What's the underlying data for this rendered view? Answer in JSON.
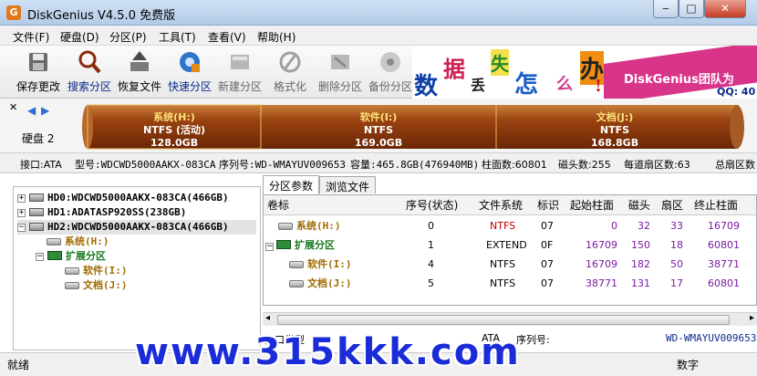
{
  "window": {
    "title": "DiskGenius V4.5.0 免费版",
    "icon_letter": "G"
  },
  "menu": [
    "文件(F)",
    "硬盘(D)",
    "分区(P)",
    "工具(T)",
    "查看(V)",
    "帮助(H)"
  ],
  "toolbar": [
    {
      "label": "保存更改",
      "icon": "save-icon"
    },
    {
      "label": "搜索分区",
      "icon": "search-partition-icon"
    },
    {
      "label": "恢复文件",
      "icon": "recover-file-icon"
    },
    {
      "label": "快速分区",
      "icon": "quick-partition-icon"
    },
    {
      "label": "新建分区",
      "icon": "new-partition-icon"
    },
    {
      "label": "格式化",
      "icon": "format-icon"
    },
    {
      "label": "删除分区",
      "icon": "delete-partition-icon"
    },
    {
      "label": "备份分区",
      "icon": "backup-partition-icon"
    }
  ],
  "banner": {
    "chars": [
      "数",
      "据",
      "丢",
      "失",
      "怎",
      "么",
      "办",
      "!"
    ],
    "brand": "DiskGenius团队为",
    "qq": "QQ: 40"
  },
  "disk": {
    "label": "硬盘 2",
    "partitions": [
      {
        "name": "系统(H:)",
        "fs": "NTFS (活动)",
        "size": "128.0GB"
      },
      {
        "name": "软件(I:)",
        "fs": "NTFS",
        "size": "169.0GB"
      },
      {
        "name": "文档(J:)",
        "fs": "NTFS",
        "size": "168.8GB"
      }
    ]
  },
  "infoline": {
    "interface": "接口:ATA",
    "model": "型号:WDCWD5000AAKX-083CA",
    "serial": "序列号:WD-WMAYUV009653",
    "capacity": "容量:465.8GB(476940MB)",
    "cylinders": "柱面数:60801",
    "heads": "磁头数:255",
    "sectors": "每道扇区数:63",
    "total": "总扇区数"
  },
  "tree": [
    {
      "text": "HD0:WDCWD5000AAKX-083CA(466GB)",
      "expander": "+"
    },
    {
      "text": "HD1:ADATASP920SS(238GB)",
      "expander": "+"
    },
    {
      "text": "HD2:WDCWD5000AAKX-083CA(466GB)",
      "expander": "−"
    },
    {
      "text": "系统(H:)"
    },
    {
      "text": "扩展分区",
      "expander": "−"
    },
    {
      "text": "软件(I:)"
    },
    {
      "text": "文档(J:)"
    }
  ],
  "tabs": [
    "分区参数",
    "浏览文件"
  ],
  "table": {
    "headers": [
      "卷标",
      "序号(状态)",
      "文件系统",
      "标识",
      "起始柱面",
      "磁头",
      "扇区",
      "终止柱面"
    ],
    "rows": [
      {
        "label": "系统(H:)",
        "index": "0",
        "fs": "NTFS",
        "id": "07",
        "start": "0",
        "head": "32",
        "sector": "33",
        "end": "16709"
      },
      {
        "label": "扩展分区",
        "index": "1",
        "fs": "EXTEND",
        "id": "0F",
        "start": "16709",
        "head": "150",
        "sector": "18",
        "end": "60801"
      },
      {
        "label": "软件(I:)",
        "index": "4",
        "fs": "NTFS",
        "id": "07",
        "start": "16709",
        "head": "182",
        "sector": "50",
        "end": "38771"
      },
      {
        "label": "文档(J:)",
        "index": "5",
        "fs": "NTFS",
        "id": "07",
        "start": "38771",
        "head": "131",
        "sector": "17",
        "end": "60801"
      }
    ]
  },
  "iface": {
    "label": "接口类型",
    "value": "ATA",
    "serial_label": "序列号:",
    "serial_value": "WD-WMAYUV009653"
  },
  "status": {
    "text": "就绪",
    "num": "数字"
  },
  "watermark": "www.315kkk.com",
  "colors": {
    "partition_fill": "#8a3a0c",
    "accent_blue": "#1a2cd8",
    "extended_green": "#187a1e",
    "number_purple": "#7a1aa5"
  }
}
